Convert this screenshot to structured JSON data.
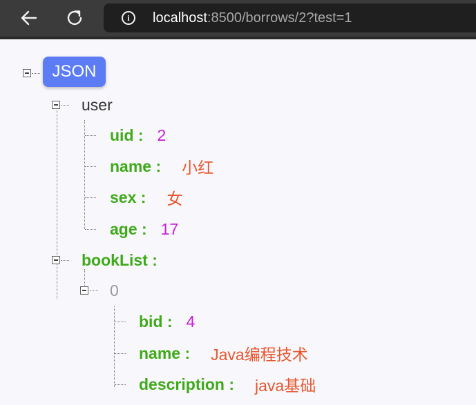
{
  "browser": {
    "url_host": "localhost",
    "url_rest": ":8500/borrows/2?test=1"
  },
  "json": {
    "root_label": "JSON",
    "user": {
      "label": "user",
      "uid_key": "uid :",
      "uid_value": "2",
      "name_key": "name :",
      "name_value": "小红",
      "sex_key": "sex :",
      "sex_value": "女",
      "age_key": "age :",
      "age_value": "17"
    },
    "bookList": {
      "label": "bookList :",
      "item0": {
        "index": "0",
        "bid_key": "bid :",
        "bid_value": "4",
        "name_key": "name :",
        "name_value": "Java编程技术",
        "description_key": "description :",
        "description_value": "java基础"
      }
    }
  }
}
